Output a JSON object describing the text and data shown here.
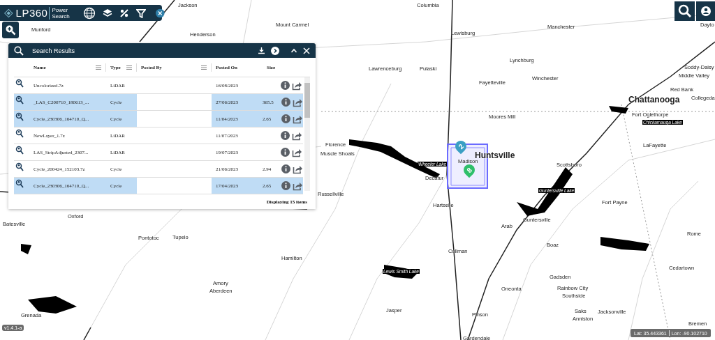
{
  "toolbar": {
    "logo": "LP360",
    "subtitle": "Power Search"
  },
  "map": {
    "labels": [
      {
        "text": "Jackson",
        "kind": "city"
      },
      {
        "text": "Columbia",
        "kind": "city"
      },
      {
        "text": "Mount Carmel",
        "kind": "city"
      },
      {
        "text": "Munford",
        "kind": "city"
      },
      {
        "text": "Henderson",
        "kind": "city"
      },
      {
        "text": "Lewisburg",
        "kind": "city"
      },
      {
        "text": "Manchester",
        "kind": "city"
      },
      {
        "text": "Dayto",
        "kind": "city"
      },
      {
        "text": "Lynchburg",
        "kind": "city"
      },
      {
        "text": "Soddy-Daisy",
        "kind": "city"
      },
      {
        "text": "Middle Valley",
        "kind": "city"
      },
      {
        "text": "Lawrenceburg",
        "kind": "city"
      },
      {
        "text": "Pulaski",
        "kind": "city"
      },
      {
        "text": "Fayetteville",
        "kind": "city"
      },
      {
        "text": "Winchester",
        "kind": "city"
      },
      {
        "text": "Red Bank",
        "kind": "city"
      },
      {
        "text": "Collegeda",
        "kind": "city"
      },
      {
        "text": "Chattanooga",
        "kind": "major"
      },
      {
        "text": "Fort Oglethorpe",
        "kind": "city"
      },
      {
        "text": "Chickamauga Lake",
        "kind": "lake"
      },
      {
        "text": "Moores Mill",
        "kind": "city"
      },
      {
        "text": "Florence",
        "kind": "city"
      },
      {
        "text": "Muscle Shoals",
        "kind": "city"
      },
      {
        "text": "Huntsville",
        "kind": "major"
      },
      {
        "text": "Madison",
        "kind": "city"
      },
      {
        "text": "Wheeler Lake",
        "kind": "lake"
      },
      {
        "text": "Decatur",
        "kind": "city"
      },
      {
        "text": "Scottsboro",
        "kind": "city"
      },
      {
        "text": "LaFayette",
        "kind": "city"
      },
      {
        "text": "Guntersville Lake",
        "kind": "lake"
      },
      {
        "text": "Russellville",
        "kind": "city"
      },
      {
        "text": "Hartselle",
        "kind": "city"
      },
      {
        "text": "Fort Payne",
        "kind": "city"
      },
      {
        "text": "Guntersville",
        "kind": "city"
      },
      {
        "text": "Arab",
        "kind": "city"
      },
      {
        "text": "Batesville",
        "kind": "city"
      },
      {
        "text": "Oxford",
        "kind": "city"
      },
      {
        "text": "Pontotoc",
        "kind": "city"
      },
      {
        "text": "Tupelo",
        "kind": "city"
      },
      {
        "text": "Boaz",
        "kind": "city"
      },
      {
        "text": "Rome",
        "kind": "city"
      },
      {
        "text": "Hamilton",
        "kind": "city"
      },
      {
        "text": "Cullman",
        "kind": "city"
      },
      {
        "text": "Cedartown",
        "kind": "city"
      },
      {
        "text": "Lewis Smith Lake",
        "kind": "lake"
      },
      {
        "text": "Gadsden",
        "kind": "city"
      },
      {
        "text": "Rainbow City",
        "kind": "city"
      },
      {
        "text": "Southside",
        "kind": "city"
      },
      {
        "text": "Amory",
        "kind": "city"
      },
      {
        "text": "Aberdeen",
        "kind": "city"
      },
      {
        "text": "Oneonta",
        "kind": "city"
      },
      {
        "text": "Jasper",
        "kind": "city"
      },
      {
        "text": "Saks",
        "kind": "city"
      },
      {
        "text": "Jacksonville",
        "kind": "city"
      },
      {
        "text": "Anniston",
        "kind": "city"
      },
      {
        "text": "Grenada",
        "kind": "city"
      },
      {
        "text": "Pinson",
        "kind": "city"
      },
      {
        "text": "Bremen",
        "kind": "city"
      },
      {
        "text": "Gardendale",
        "kind": "city"
      }
    ],
    "markers": [
      {
        "count": "2",
        "color": "#3a9fc4"
      },
      {
        "count": "8",
        "color": "#2fbf6a"
      }
    ]
  },
  "panel": {
    "title": "Search Results",
    "columns": [
      "Name",
      "Type",
      "Posted By",
      "Posted On",
      "Size"
    ],
    "rows": [
      {
        "name": "Uncolorized.7z",
        "type": "LiDAR",
        "posted_on": "16/08/2023",
        "selected": false
      },
      {
        "name": "_LAS_C200710_180613_...",
        "type": "Cycle",
        "posted_on": "27/06/2023",
        "size": "365.5",
        "selected": true
      },
      {
        "name": "Cycle_230306_164710_Q...",
        "type": "Cycle",
        "posted_on": "11/04/2023",
        "size": "2.65",
        "selected": true
      },
      {
        "name": "NewLayer_1.7z",
        "type": "LiDAR",
        "posted_on": "11/07/2023",
        "selected": false
      },
      {
        "name": "LAS_StripAdjusted_2307...",
        "type": "LiDAR",
        "posted_on": "19/07/2023",
        "selected": false
      },
      {
        "name": "Cycle_200424_152103.7z",
        "type": "Cycle",
        "posted_on": "21/06/2023",
        "size": "2.94",
        "selected": false
      },
      {
        "name": "Cycle_230306_164710_Q...",
        "type": "Cycle",
        "posted_on": "17/04/2023",
        "size": "2.65",
        "selected": true
      }
    ],
    "footer": "Displaying 15 items"
  },
  "version": "v1.4.1-a",
  "coords": {
    "lat": "Lat: 35.443361",
    "lon": "Lon: -90.102710"
  }
}
